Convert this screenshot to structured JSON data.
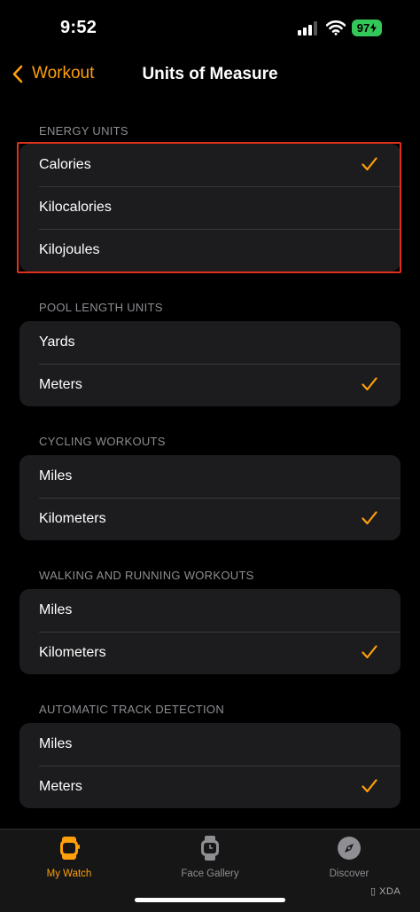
{
  "status": {
    "time": "9:52",
    "battery": "97"
  },
  "nav": {
    "back_label": "Workout",
    "title": "Units of Measure"
  },
  "sections": [
    {
      "header": "ENERGY UNITS",
      "rows": [
        {
          "label": "Calories",
          "checked": true
        },
        {
          "label": "Kilocalories",
          "checked": false
        },
        {
          "label": "Kilojoules",
          "checked": false
        }
      ]
    },
    {
      "header": "POOL LENGTH UNITS",
      "rows": [
        {
          "label": "Yards",
          "checked": false
        },
        {
          "label": "Meters",
          "checked": true
        }
      ]
    },
    {
      "header": "CYCLING WORKOUTS",
      "rows": [
        {
          "label": "Miles",
          "checked": false
        },
        {
          "label": "Kilometers",
          "checked": true
        }
      ]
    },
    {
      "header": "WALKING AND RUNNING WORKOUTS",
      "rows": [
        {
          "label": "Miles",
          "checked": false
        },
        {
          "label": "Kilometers",
          "checked": true
        }
      ]
    },
    {
      "header": "AUTOMATIC TRACK DETECTION",
      "rows": [
        {
          "label": "Miles",
          "checked": false
        },
        {
          "label": "Meters",
          "checked": true
        }
      ]
    }
  ],
  "tabs": [
    {
      "label": "My Watch",
      "icon": "watch-icon",
      "active": true
    },
    {
      "label": "Face Gallery",
      "icon": "watch-face-icon",
      "active": false
    },
    {
      "label": "Discover",
      "icon": "compass-icon",
      "active": false
    }
  ],
  "watermark": "XDA",
  "colors": {
    "accent": "#ff9f0a",
    "highlight": "#e0301e",
    "battery": "#34c759",
    "group_bg": "#1c1c1e"
  }
}
